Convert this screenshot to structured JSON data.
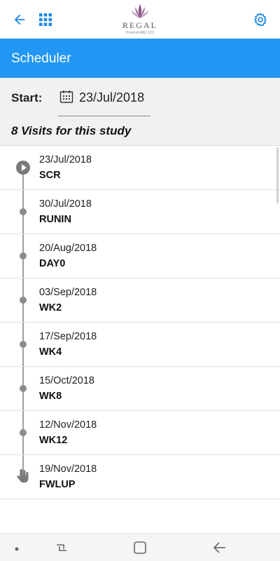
{
  "topbar": {
    "back_icon": "arrow-left-icon",
    "apps_icon": "grid-icon",
    "settings_icon": "gear-icon",
    "logo": {
      "brand": "REGAL",
      "protocol": "Protocol ABC-123"
    }
  },
  "colors": {
    "accent": "#2196f3",
    "timeline": "#9e9e9e",
    "header_bg": "#f1f1f1"
  },
  "titlebar": {
    "title": "Scheduler"
  },
  "start": {
    "label": "Start:",
    "date": "23/Jul/2018"
  },
  "visits_header": "8 Visits for this study",
  "visits": [
    {
      "date": "23/Jul/2018",
      "code": "SCR",
      "marker": "play-icon"
    },
    {
      "date": "30/Jul/2018",
      "code": "RUNIN",
      "marker": "dot"
    },
    {
      "date": "20/Aug/2018",
      "code": "DAY0",
      "marker": "dot"
    },
    {
      "date": "03/Sep/2018",
      "code": "WK2",
      "marker": "dot"
    },
    {
      "date": "17/Sep/2018",
      "code": "WK4",
      "marker": "dot"
    },
    {
      "date": "15/Oct/2018",
      "code": "WK8",
      "marker": "dot"
    },
    {
      "date": "12/Nov/2018",
      "code": "WK12",
      "marker": "dot"
    },
    {
      "date": "19/Nov/2018",
      "code": "FWLUP",
      "marker": "hand-icon"
    }
  ],
  "navbar": {
    "items": [
      "dot-icon",
      "recent-apps-icon",
      "home-icon",
      "back-icon"
    ]
  }
}
